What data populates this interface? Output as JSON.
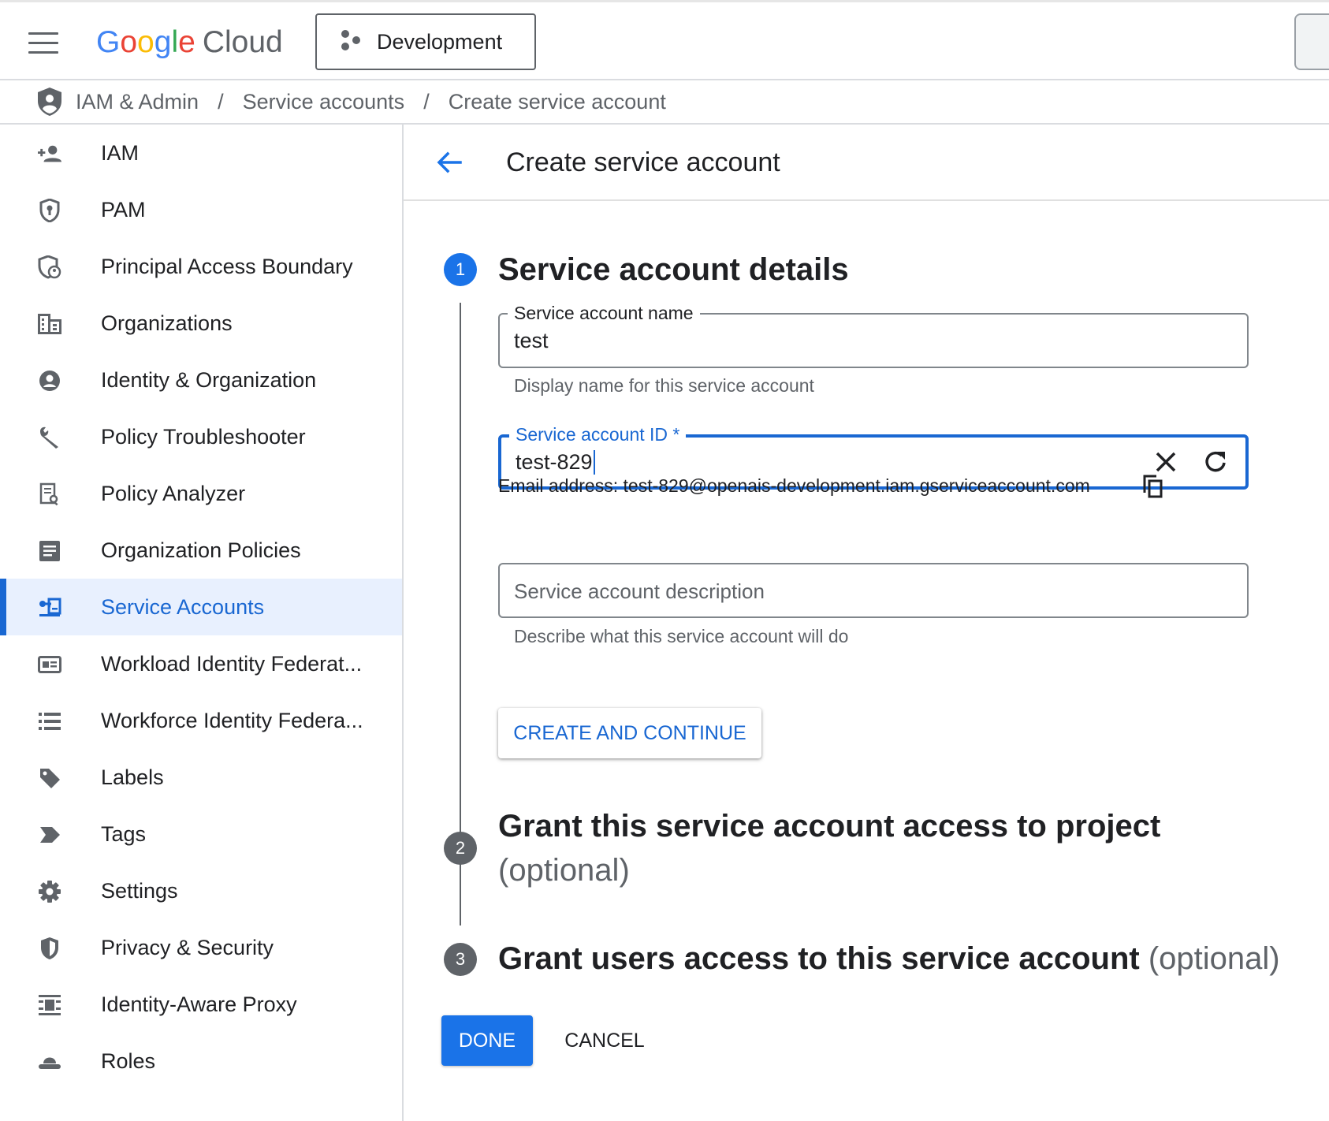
{
  "topbar": {
    "logo_letters": [
      {
        "ch": "G",
        "color": "#4285F4"
      },
      {
        "ch": "o",
        "color": "#EA4335"
      },
      {
        "ch": "o",
        "color": "#FBBC05"
      },
      {
        "ch": "g",
        "color": "#4285F4"
      },
      {
        "ch": "l",
        "color": "#34A853"
      },
      {
        "ch": "e",
        "color": "#EA4335"
      }
    ],
    "logo_suffix": "Cloud",
    "project_name": "Development",
    "icons": {
      "menu": "menu-icon",
      "project": "project-hub-icon"
    }
  },
  "breadcrumb": {
    "icon": "shield-icon",
    "items": [
      "IAM & Admin",
      "Service accounts",
      "Create service account"
    ],
    "separator": "/"
  },
  "sidebar": {
    "items": [
      {
        "label": "IAM",
        "icon": "person-add-icon",
        "active": false
      },
      {
        "label": "PAM",
        "icon": "shield-lock-icon",
        "active": false
      },
      {
        "label": "Principal Access Boundary",
        "icon": "shield-person-icon",
        "active": false
      },
      {
        "label": "Organizations",
        "icon": "building-icon",
        "active": false
      },
      {
        "label": "Identity & Organization",
        "icon": "account-circle-icon",
        "active": false
      },
      {
        "label": "Policy Troubleshooter",
        "icon": "wrench-icon",
        "active": false
      },
      {
        "label": "Policy Analyzer",
        "icon": "document-search-icon",
        "active": false
      },
      {
        "label": "Organization Policies",
        "icon": "article-icon",
        "active": false
      },
      {
        "label": "Service Accounts",
        "icon": "service-account-icon",
        "active": true
      },
      {
        "label": "Workload Identity Federat...",
        "icon": "id-card-icon",
        "active": false
      },
      {
        "label": "Workforce Identity Federa...",
        "icon": "list-icon",
        "active": false
      },
      {
        "label": "Labels",
        "icon": "label-tag-icon",
        "active": false
      },
      {
        "label": "Tags",
        "icon": "tag-chevron-icon",
        "active": false
      },
      {
        "label": "Settings",
        "icon": "gear-icon",
        "active": false
      },
      {
        "label": "Privacy & Security",
        "icon": "privacy-shield-icon",
        "active": false
      },
      {
        "label": "Identity-Aware Proxy",
        "icon": "proxy-icon",
        "active": false
      },
      {
        "label": "Roles",
        "icon": "hat-icon",
        "active": false
      }
    ]
  },
  "main": {
    "title": "Create service account",
    "steps": [
      {
        "number": "1",
        "title": "Service account details",
        "optional": ""
      },
      {
        "number": "2",
        "title": "Grant this service account access to project",
        "optional": "(optional)"
      },
      {
        "number": "3",
        "title": "Grant users access to this service account",
        "optional": "(optional)"
      }
    ],
    "form": {
      "name_label": "Service account name",
      "name_value": "test",
      "name_hint": "Display name for this service account",
      "id_label": "Service account ID *",
      "id_value": "test-829",
      "email_text": "Email address: test-829@openais-development.iam.gserviceaccount.com",
      "description_placeholder": "Service account description",
      "description_hint": "Describe what this service account will do"
    },
    "buttons": {
      "create_continue": "CREATE AND CONTINUE",
      "done": "DONE",
      "cancel": "CANCEL"
    }
  },
  "colors": {
    "accent": "#1967d2",
    "step_active": "#1a73e8",
    "step_inactive": "#5f6368",
    "active_bg": "#e8f0fe"
  }
}
